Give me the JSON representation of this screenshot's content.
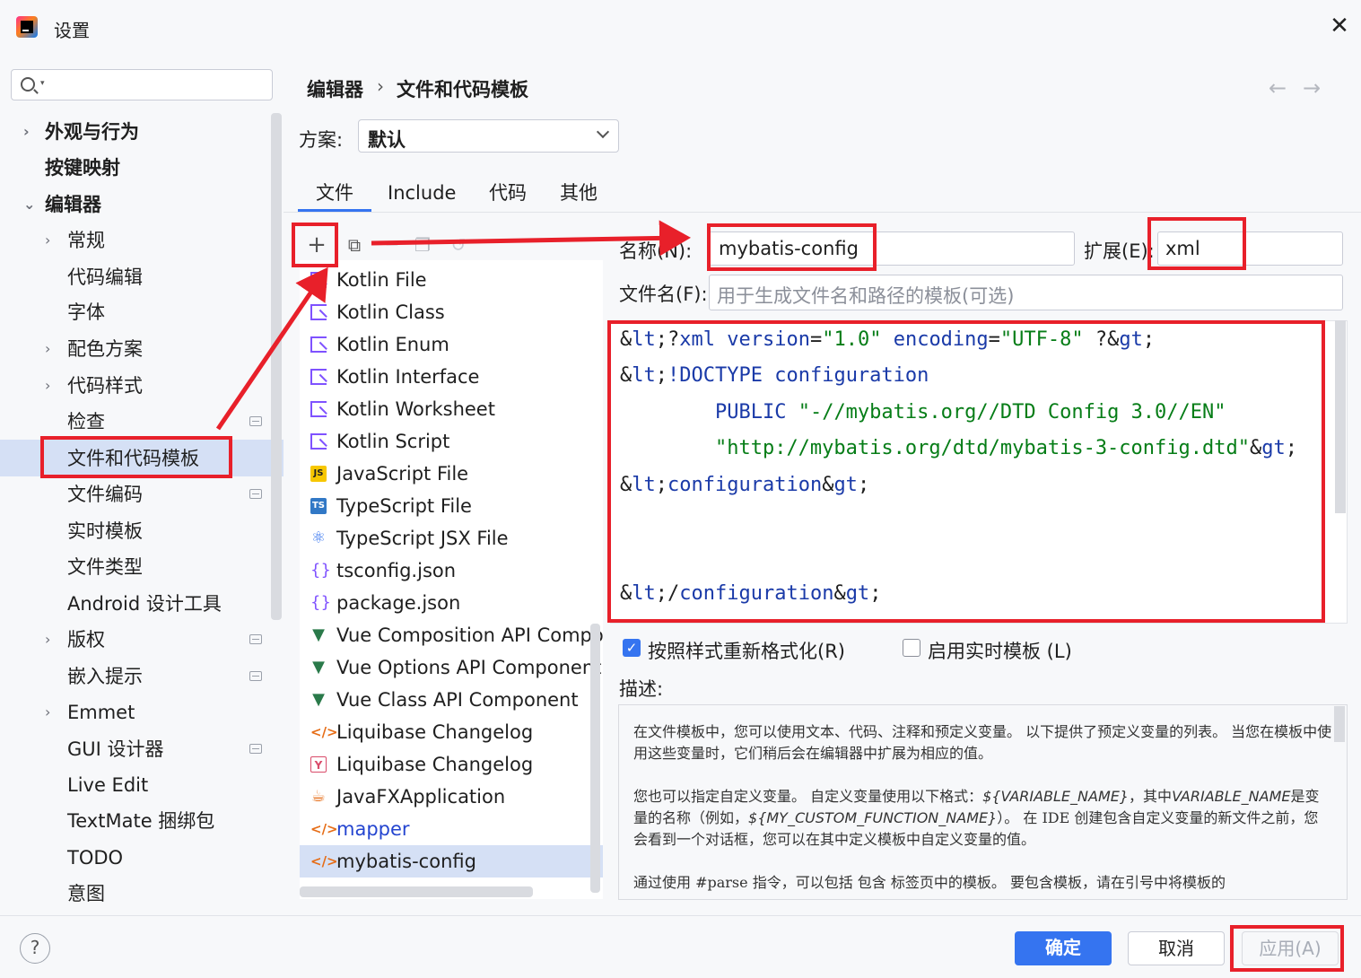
{
  "window": {
    "title": "设置",
    "close_icon": "✕"
  },
  "search": {
    "placeholder": ""
  },
  "sidebar": {
    "items": [
      {
        "label": "外观与行为",
        "chevron": "›",
        "bold": true
      },
      {
        "label": "按键映射",
        "bold": true
      },
      {
        "label": "编辑器",
        "chevron": "⌄",
        "bold": true
      },
      {
        "label": "常规",
        "chevron": "›"
      },
      {
        "label": "代码编辑"
      },
      {
        "label": "字体"
      },
      {
        "label": "配色方案",
        "chevron": "›"
      },
      {
        "label": "代码样式",
        "chevron": "›"
      },
      {
        "label": "检查"
      },
      {
        "label": "文件和代码模板",
        "selected": true
      },
      {
        "label": "文件编码"
      },
      {
        "label": "实时模板"
      },
      {
        "label": "文件类型"
      },
      {
        "label": "Android 设计工具"
      },
      {
        "label": "版权",
        "chevron": "›"
      },
      {
        "label": "嵌入提示"
      },
      {
        "label": "Emmet",
        "chevron": "›"
      },
      {
        "label": "GUI 设计器"
      },
      {
        "label": "Live Edit"
      },
      {
        "label": "TextMate 捆绑包"
      },
      {
        "label": "TODO"
      },
      {
        "label": "意图"
      }
    ]
  },
  "breadcrumb": {
    "parent": "编辑器",
    "separator": "›",
    "current": "文件和代码模板",
    "back_icon": "←",
    "forward_icon": "→"
  },
  "scheme": {
    "label": "方案:",
    "value": "默认"
  },
  "tabs": [
    "文件",
    "Include",
    "代码",
    "其他"
  ],
  "toolbar": {
    "add_icon": "+",
    "copy_icon": "⧉",
    "remove_icon": "—",
    "duplicate_icon": "❐",
    "reset_icon": "↺"
  },
  "files": [
    {
      "label": "Kotlin File",
      "icon": "kotlin-icon"
    },
    {
      "label": "Kotlin Class",
      "icon": "kotlin-icon"
    },
    {
      "label": "Kotlin Enum",
      "icon": "kotlin-icon"
    },
    {
      "label": "Kotlin Interface",
      "icon": "kotlin-icon"
    },
    {
      "label": "Kotlin Worksheet",
      "icon": "kotlin-icon"
    },
    {
      "label": "Kotlin Script",
      "icon": "kotlin-icon"
    },
    {
      "label": "JavaScript File",
      "icon": "js-icon",
      "glyph": "JS"
    },
    {
      "label": "TypeScript File",
      "icon": "ts-icon",
      "glyph": "TS"
    },
    {
      "label": "TypeScript JSX File",
      "icon": "react-icon",
      "glyph": "⚛"
    },
    {
      "label": "tsconfig.json",
      "icon": "json-icon",
      "glyph": "{}"
    },
    {
      "label": "package.json",
      "icon": "json-icon",
      "glyph": "{}"
    },
    {
      "label": "Vue Composition API Component",
      "icon": "vue-icon",
      "glyph": "▼"
    },
    {
      "label": "Vue Options API Component",
      "icon": "vue-icon",
      "glyph": "▼"
    },
    {
      "label": "Vue Class API Component",
      "icon": "vue-icon",
      "glyph": "▼"
    },
    {
      "label": "Liquibase Changelog",
      "icon": "xml-icon",
      "glyph": "</>"
    },
    {
      "label": "Liquibase Changelog",
      "icon": "liquibase-icon",
      "glyph": "Y"
    },
    {
      "label": "JavaFXApplication",
      "icon": "javafx-icon",
      "glyph": "☕"
    },
    {
      "label": "mapper",
      "icon": "xml-icon",
      "glyph": "</>",
      "blue": true
    },
    {
      "label": "mybatis-config",
      "icon": "xml-icon",
      "glyph": "</>",
      "selected": true
    }
  ],
  "detail": {
    "name_label": "名称(N):",
    "name_value": "mybatis-config",
    "ext_label": "扩展(E):",
    "ext_value": "xml",
    "filename_label": "文件名(F):",
    "filename_placeholder": "用于生成文件名和路径的模板(可选)"
  },
  "editor_lines": [
    "<?xml version=\"1.0\" encoding=\"UTF-8\" ?>",
    "<!DOCTYPE configuration",
    "        PUBLIC \"-//mybatis.org//DTD Config 3.0//EN\"",
    "        \"http://mybatis.org/dtd/mybatis-3-config.dtd\">",
    "<configuration>",
    "",
    "",
    "</configuration>"
  ],
  "options": {
    "reformat_label": "按照样式重新格式化(R)",
    "reformat_checked": true,
    "live_label": "启用实时模板 (L)",
    "live_checked": false
  },
  "description": {
    "label": "描述:",
    "p1": "在文件模板中，您可以使用文本、代码、注释和预定义变量。 以下提供了预定义变量的列表。 当您在模板中使用这些变量时，它们稍后会在编辑器中扩展为相应的值。",
    "p2_a": "您也可以指定自定义变量。 自定义变量使用以下格式：",
    "p2_var1": "${VARIABLE_NAME}",
    "p2_b": "，其中",
    "p2_var2": "VARIABLE_NAME",
    "p2_c": "是变量的名称（例如，",
    "p2_var3": "${MY_CUSTOM_FUNCTION_NAME}",
    "p2_d": "）。 在 IDE 创建包含自定义变量的新文件之前，您会看到一个对话框，您可以在其中定义模板中自定义变量的值。",
    "p3": "通过使用 #parse 指令，可以包括 包含 标签页中的模板。 要包含模板，请在引号中将模板的"
  },
  "footer": {
    "help_icon": "?",
    "ok": "确定",
    "cancel": "取消",
    "apply": "应用(A)"
  },
  "colors": {
    "accent": "#3574f0",
    "annotation_red": "#e8202a",
    "selection": "#d5e0f5"
  }
}
